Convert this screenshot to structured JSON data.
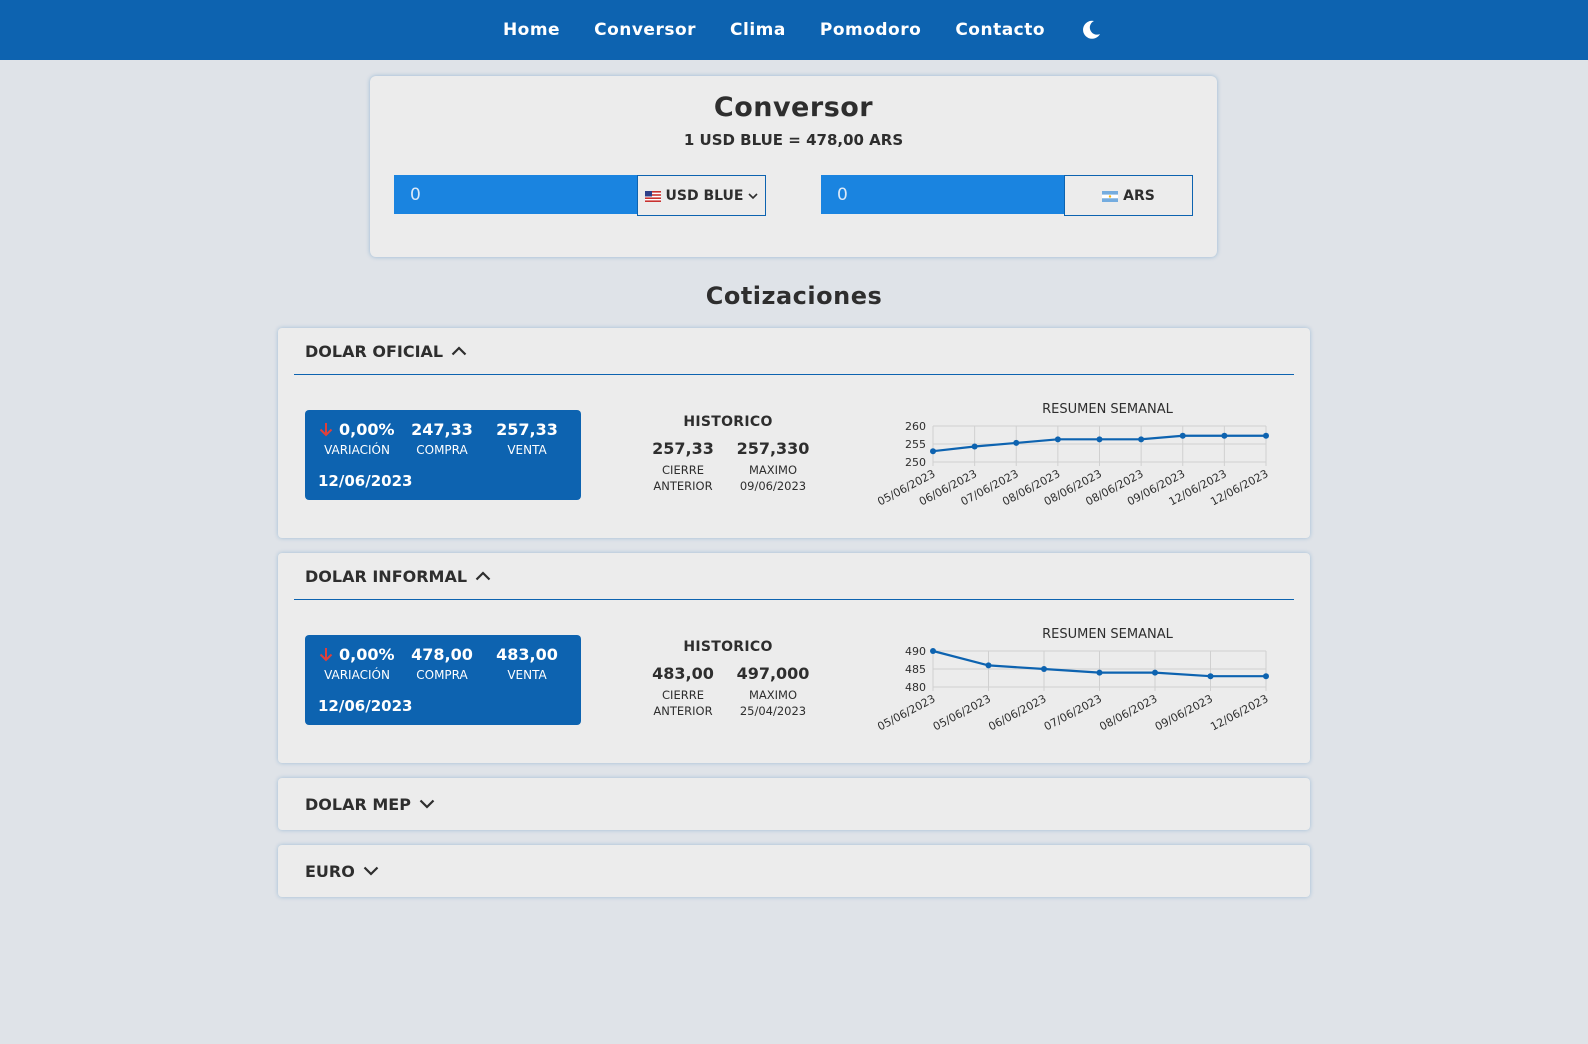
{
  "nav": {
    "items": [
      "Home",
      "Conversor",
      "Clima",
      "Pomodoro",
      "Contacto"
    ],
    "theme_icon": "moon-icon"
  },
  "converter": {
    "title": "Conversor",
    "rate": "1 USD BLUE = 478,00 ARS",
    "from_value": "0",
    "from_currency": "USD BLUE",
    "to_value": "0",
    "to_currency": "ARS"
  },
  "section_title": "Cotizaciones",
  "accordions": [
    {
      "title": "DOLAR OFICIAL",
      "expanded": true,
      "variation": "0,00%",
      "variation_label": "VARIACIÓN",
      "buy": "247,33",
      "buy_label": "COMPRA",
      "sell": "257,33",
      "sell_label": "VENTA",
      "date": "12/06/2023",
      "historic": {
        "title": "HISTORICO",
        "prev_close": "257,33",
        "prev_close_label": "CIERRE ANTERIOR",
        "max": "257,330",
        "max_label": "MAXIMO",
        "max_date": "09/06/2023"
      }
    },
    {
      "title": "DOLAR INFORMAL",
      "expanded": true,
      "variation": "0,00%",
      "variation_label": "VARIACIÓN",
      "buy": "478,00",
      "buy_label": "COMPRA",
      "sell": "483,00",
      "sell_label": "VENTA",
      "date": "12/06/2023",
      "historic": {
        "title": "HISTORICO",
        "prev_close": "483,00",
        "prev_close_label": "CIERRE ANTERIOR",
        "max": "497,000",
        "max_label": "MAXIMO",
        "max_date": "25/04/2023"
      }
    },
    {
      "title": "DOLAR MEP",
      "expanded": false
    },
    {
      "title": "EURO",
      "expanded": false
    }
  ],
  "chart_data": [
    {
      "type": "line",
      "title": "RESUMEN SEMANAL",
      "categories": [
        "05/06/2023",
        "06/06/2023",
        "07/06/2023",
        "08/06/2023",
        "08/06/2023",
        "08/06/2023",
        "09/06/2023",
        "12/06/2023",
        "12/06/2023"
      ],
      "values": [
        253,
        254.3,
        255.3,
        256.3,
        256.3,
        256.3,
        257.3,
        257.3,
        257.3
      ],
      "ylim": [
        250,
        260
      ],
      "yticks": [
        250,
        255,
        260
      ],
      "grid": true,
      "color": "#0d63b0"
    },
    {
      "type": "line",
      "title": "RESUMEN SEMANAL",
      "categories": [
        "05/06/2023",
        "05/06/2023",
        "06/06/2023",
        "07/06/2023",
        "08/06/2023",
        "09/06/2023",
        "12/06/2023"
      ],
      "values": [
        490,
        486,
        485,
        484,
        484,
        483,
        483
      ],
      "ylim": [
        480,
        490
      ],
      "yticks": [
        480,
        485,
        490
      ],
      "grid": true,
      "color": "#0d63b0"
    }
  ],
  "colors": {
    "primary": "#0d63b0",
    "input_blue": "#1a84e0",
    "background": "#dfe3e8",
    "card": "#ececec",
    "down_arrow": "#e0403a"
  }
}
